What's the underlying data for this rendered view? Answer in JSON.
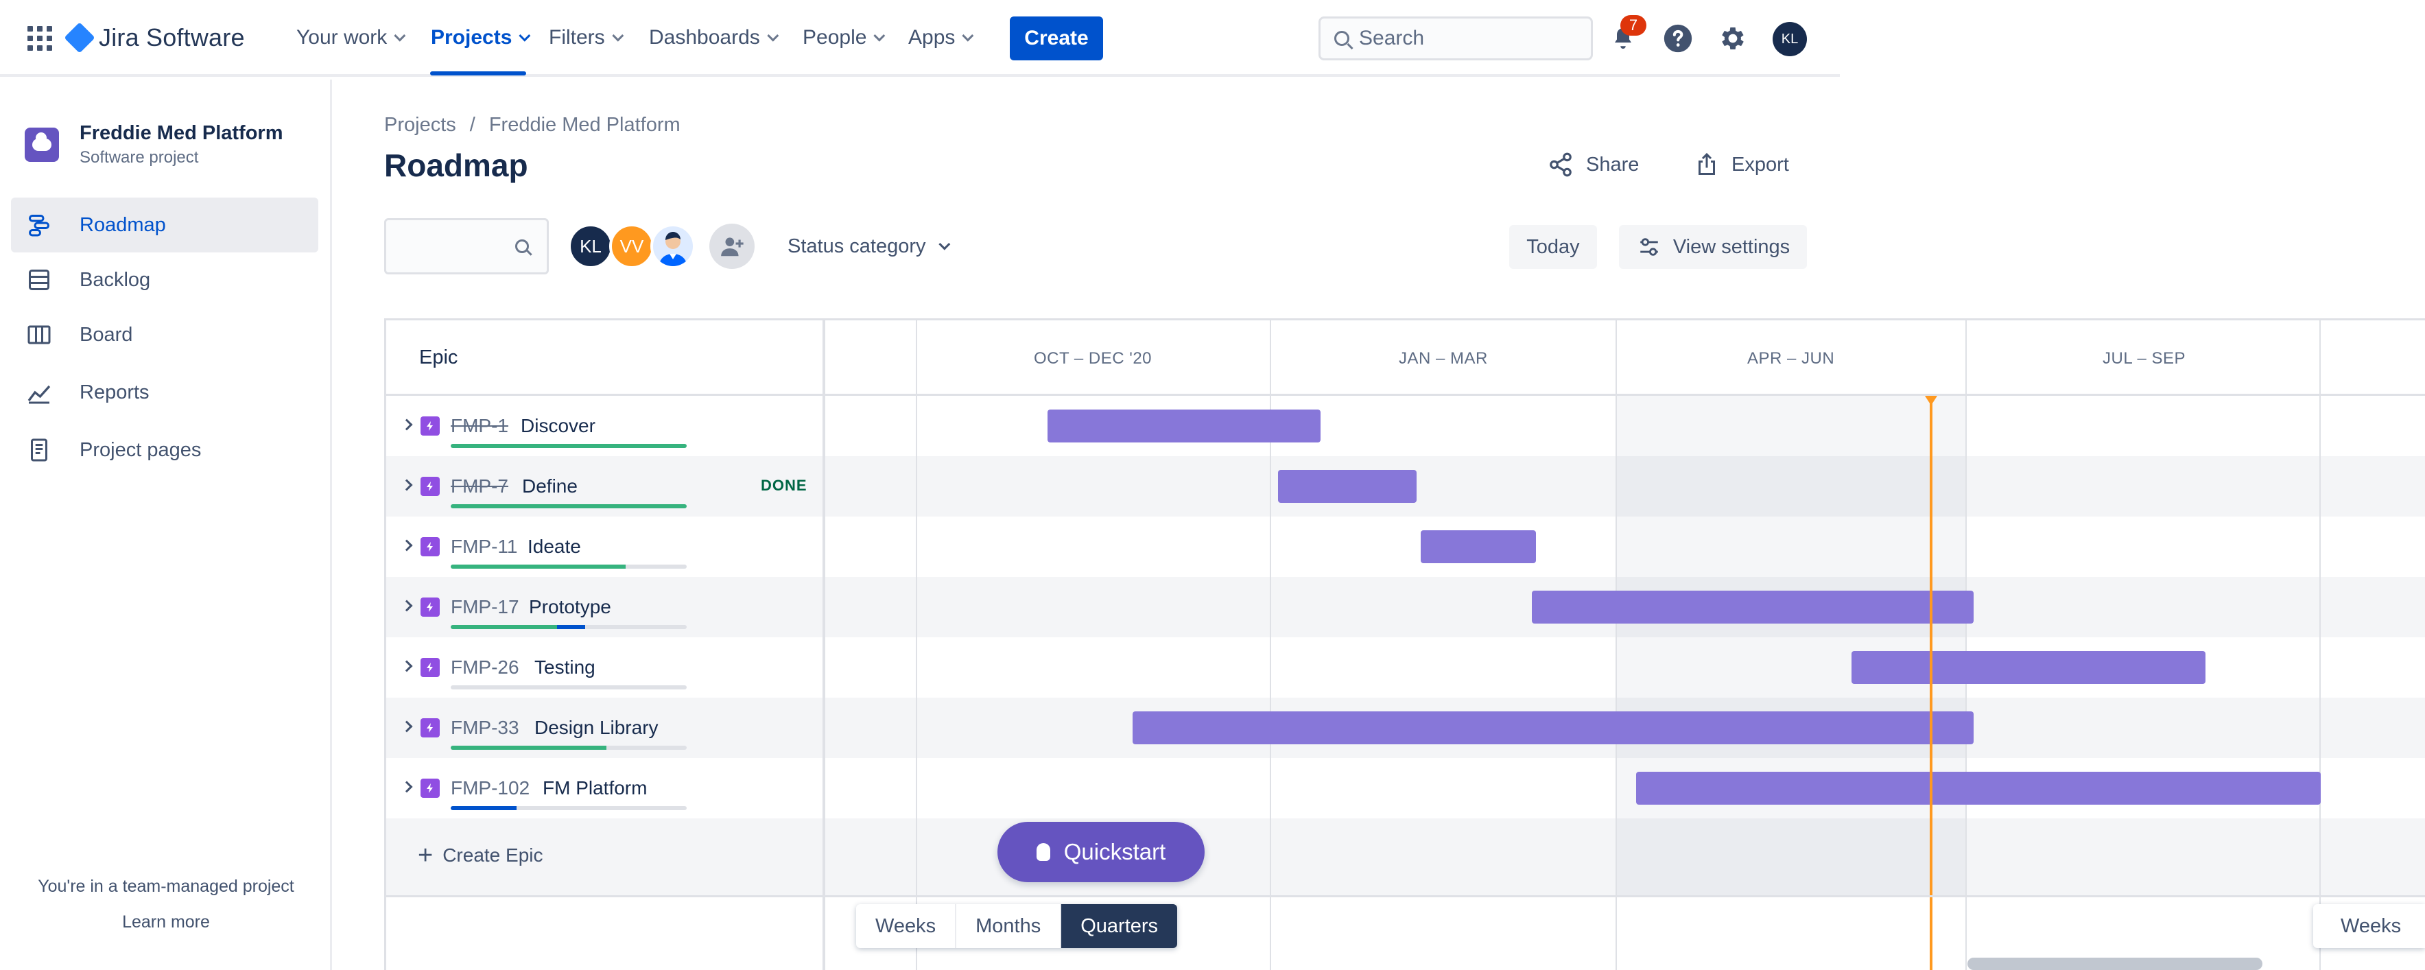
{
  "topnav": {
    "product": "Jira Software",
    "items": [
      {
        "label": "Your work"
      },
      {
        "label": "Projects"
      },
      {
        "label": "Filters"
      },
      {
        "label": "Dashboards"
      },
      {
        "label": "People"
      },
      {
        "label": "Apps"
      }
    ],
    "create_label": "Create",
    "search_placeholder": "Search",
    "notifications_count": "7",
    "user_initials": "KL"
  },
  "sidebar": {
    "project_name": "Freddie Med Platform",
    "project_type": "Software project",
    "items": [
      {
        "label": "Roadmap"
      },
      {
        "label": "Backlog"
      },
      {
        "label": "Board"
      },
      {
        "label": "Reports"
      },
      {
        "label": "Project pages"
      }
    ],
    "footer_text": "You're in a team-managed project",
    "footer_link": "Learn more"
  },
  "header": {
    "breadcrumb": [
      "Projects",
      "/",
      "Freddie Med Platform"
    ],
    "title": "Roadmap",
    "share_label": "Share",
    "export_label": "Export"
  },
  "toolbar": {
    "avatars": [
      {
        "initials": "KL",
        "color": "#172b4d"
      },
      {
        "initials": "VV",
        "color": "#ff991f"
      },
      {
        "initials": "",
        "color": "#deebff"
      }
    ],
    "status_filter": "Status category",
    "today_label": "Today",
    "view_settings_label": "View settings"
  },
  "roadmap": {
    "epic_header": "Epic",
    "quarters": [
      "OCT – DEC '20",
      "JAN – MAR",
      "APR – JUN",
      "JUL – SEP"
    ],
    "epics": [
      {
        "key": "FMP-1",
        "name": "Discover",
        "done": true,
        "status": "",
        "progress_done": 1.0,
        "progress_inprogress": 0.0
      },
      {
        "key": "FMP-7",
        "name": "Define",
        "done": true,
        "status": "DONE",
        "progress_done": 1.0,
        "progress_inprogress": 0.0
      },
      {
        "key": "FMP-11",
        "name": "Ideate",
        "done": false,
        "status": "",
        "progress_done": 0.74,
        "progress_inprogress": 0.0
      },
      {
        "key": "FMP-17",
        "name": "Prototype",
        "done": false,
        "status": "",
        "progress_done": 0.45,
        "progress_inprogress": 0.12
      },
      {
        "key": "FMP-26",
        "name": "Testing",
        "done": false,
        "status": "",
        "progress_done": 0.0,
        "progress_inprogress": 0.0
      },
      {
        "key": "FMP-33",
        "name": "Design Library",
        "done": false,
        "status": "",
        "progress_done": 0.66,
        "progress_inprogress": 0.0
      },
      {
        "key": "FMP-102",
        "name": "FM Platform",
        "done": false,
        "status": "",
        "progress_done": 0.0,
        "progress_inprogress": 0.28
      }
    ],
    "create_epic_label": "Create Epic",
    "colors": {
      "bar": "#8777d9",
      "today": "#ff991f",
      "done": "#36b37e",
      "in_progress": "#0052cc"
    }
  },
  "quickstart_label": "Quickstart",
  "zoom": {
    "options": [
      "Weeks",
      "Months",
      "Quarters"
    ],
    "selected": "Quarters",
    "right_label": "Weeks"
  }
}
